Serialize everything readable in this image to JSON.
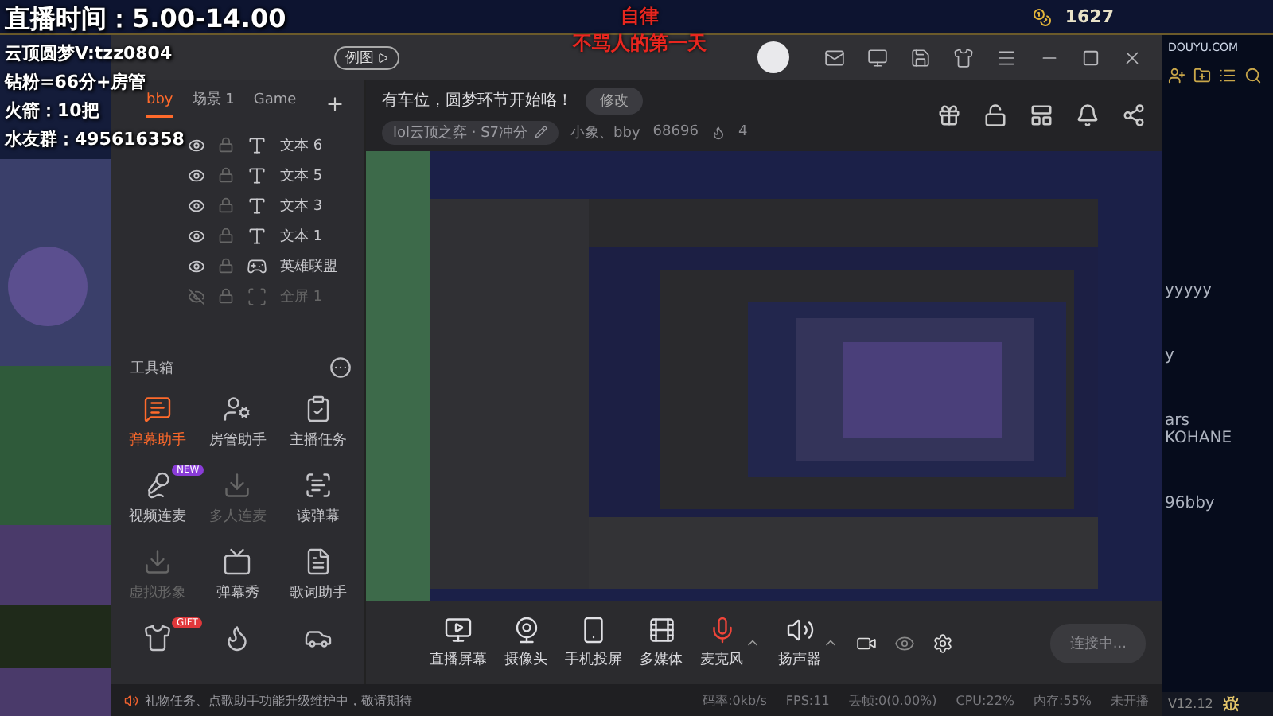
{
  "overlay": {
    "lines": [
      {
        "text": "直播时间：5.00-14.00",
        "kind": "title"
      },
      {
        "text": "云顶圆梦V:tzz0804",
        "kind": "line"
      },
      {
        "text": "钻粉=66分+房管",
        "kind": "line"
      },
      {
        "text": "火箭：10把",
        "kind": "line"
      },
      {
        "text": "水友群：495616358",
        "kind": "line"
      }
    ],
    "motto": [
      "自律",
      "不骂人的第一天"
    ]
  },
  "game_bar": {
    "coins": "1627",
    "logo": "DOUYU.COM"
  },
  "window": {
    "badge": "例图"
  },
  "scene_tabs": [
    {
      "label": "bby",
      "selected": true
    },
    {
      "label": "场景 1",
      "selected": false
    },
    {
      "label": "Game",
      "selected": false
    }
  ],
  "layers": [
    {
      "name": "文本 6",
      "kind": "text",
      "visible": true
    },
    {
      "name": "文本 5",
      "kind": "text",
      "visible": true
    },
    {
      "name": "文本 3",
      "kind": "text",
      "visible": true
    },
    {
      "name": "文本 1",
      "kind": "text",
      "visible": true
    },
    {
      "name": "英雄联盟",
      "kind": "game",
      "visible": true
    },
    {
      "name": "全屏 1",
      "kind": "screen",
      "visible": false
    }
  ],
  "toolbox": {
    "title": "工具箱",
    "tools": [
      {
        "label": "弹幕助手",
        "selected": true,
        "disabled": false
      },
      {
        "label": "房管助手",
        "selected": false,
        "disabled": false
      },
      {
        "label": "主播任务",
        "selected": false,
        "disabled": false
      },
      {
        "label": "视频连麦",
        "selected": false,
        "disabled": false,
        "badge": "NEW"
      },
      {
        "label": "多人连麦",
        "selected": false,
        "disabled": true
      },
      {
        "label": "读弹幕",
        "selected": false,
        "disabled": false
      },
      {
        "label": "虚拟形象",
        "selected": false,
        "disabled": true
      },
      {
        "label": "弹幕秀",
        "selected": false,
        "disabled": false
      },
      {
        "label": "歌词助手",
        "selected": false,
        "disabled": false
      },
      {
        "selected": false,
        "disabled": false,
        "badge": "GIFT"
      },
      {
        "selected": false,
        "disabled": false
      },
      {
        "selected": false,
        "disabled": false
      }
    ]
  },
  "room": {
    "notice": "有车位，圆梦环节开始咯！",
    "edit_button": "修改",
    "category": "lol云顶之弈 · S7冲分",
    "host": "小象、bby",
    "room_id": "68696",
    "fans": "4"
  },
  "sources": [
    {
      "label": "直播屏幕",
      "active": false,
      "expandable": false
    },
    {
      "label": "摄像头",
      "active": false,
      "expandable": false
    },
    {
      "label": "手机投屏",
      "active": false,
      "expandable": false
    },
    {
      "label": "多媒体",
      "active": false,
      "expandable": false
    },
    {
      "label": "麦克风",
      "active": true,
      "expandable": true
    },
    {
      "label": "扬声器",
      "active": false,
      "expandable": true
    }
  ],
  "connect_button": "连接中...",
  "status_bar": {
    "notice": "礼物任务、点歌助手功能升级维护中，敬请期待",
    "stats": [
      "码率:0kb/s",
      "FPS:11",
      "丢帧:0(0.00%)",
      "CPU:22%",
      "内存:55%"
    ],
    "state": "未开播",
    "version": "V12.12"
  },
  "friend_list": [
    "yyyyy",
    "y",
    "ars",
    "KOHANE",
    "96bby"
  ]
}
